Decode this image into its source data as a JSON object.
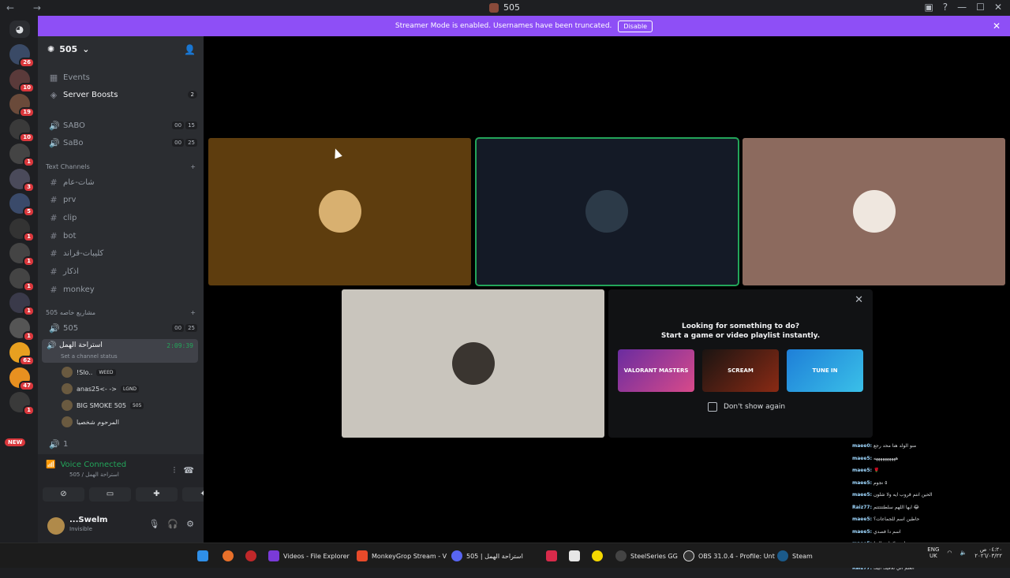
{
  "titlebar": {
    "title": "505",
    "nav": "← →"
  },
  "servers": {
    "badges": [
      "26",
      "10",
      "19",
      "10",
      "1",
      "3",
      "5",
      "1",
      "1",
      "1",
      "1",
      "1",
      "62",
      "47",
      "1"
    ],
    "new_label": "NEW"
  },
  "banner": {
    "text": "Streamer Mode is enabled. Usernames have been truncated.",
    "button": "Disable"
  },
  "sidebar": {
    "server_name": "505",
    "events": "Events",
    "boosts": "Server Boosts",
    "boosts_count": "2",
    "voice1": {
      "name": "SABO",
      "a": "00",
      "b": "15"
    },
    "voice2": {
      "name": "SaBo",
      "a": "00",
      "b": "25"
    },
    "text_channels_header": "Text Channels",
    "channels": [
      "شات-عام",
      "prv",
      "clip",
      "bot",
      "كليبات-قراند",
      "اذكار",
      "monkey"
    ],
    "category2": "505 مشاريع خاصه",
    "voice3": {
      "name": "505",
      "a": "00",
      "b": "25"
    },
    "active_voice": {
      "name": "استراحة الهمل",
      "time": "2:09:39",
      "status": "Set a channel status"
    },
    "users": [
      {
        "name": "!Slo..",
        "tag": "WEED"
      },
      {
        "name": "anas25<- ->",
        "tag": "LGND"
      },
      {
        "name": "BIG SMOKE 505",
        "tag": "505"
      },
      {
        "name": "المرحوم شخصيا",
        "tag": ""
      }
    ],
    "voice4": "1"
  },
  "voice_panel": {
    "status": "Voice Connected",
    "sub": "505 / استراحة الهمل"
  },
  "user_panel": {
    "name": "...Swelm",
    "status": "Invisible"
  },
  "promo": {
    "line1": "Looking for something to do?",
    "line2": "Start a game or video playlist instantly.",
    "cards": [
      "VALORANT MASTERS",
      "SCREAM",
      "TUNE IN"
    ],
    "checkbox": "Don't show again"
  },
  "chat": [
    {
      "user": "maee0:",
      "msg": "منو الولد هنا محد رجع"
    },
    {
      "user": "maee5:",
      "msg": "ههههههههههه"
    },
    {
      "user": "maee5:",
      "msg": "🌹"
    },
    {
      "user": "maee5:",
      "msg": "٥ نجوم"
    },
    {
      "user": "maee5:",
      "msg": "الحين انتم قروب ايه ولا شلون"
    },
    {
      "user": "Raiz77:",
      "msg": "ايها اللهم سلطتتتتتم 😂"
    },
    {
      "user": "maee5:",
      "msg": "حاطين اسم للجماعات؟"
    },
    {
      "user": "maee5:",
      "msg": "اسم دا فصدي"
    },
    {
      "user": "maee5:",
      "msg": "! اسم لا يا رجال"
    },
    {
      "user": "Raiz77:",
      "msg": "فيك حاله يا رجال 😂"
    },
    {
      "user": "Raiz77:",
      "msg": "العلم الي تلاقيك ابيك"
    }
  ],
  "taskbar": {
    "items": [
      "Videos - File Explorer",
      "MonkeyGrop Stream - V",
      "505 | استراحة الهمل",
      "SteelSeries GG",
      "OBS 31.0.4 - Profile: Unt",
      "Steam"
    ],
    "lang": "ENG",
    "region": "UK",
    "time": "٠٤:٢٠ ص",
    "date": "٢٠٢٦/٠٣/٢٢"
  }
}
